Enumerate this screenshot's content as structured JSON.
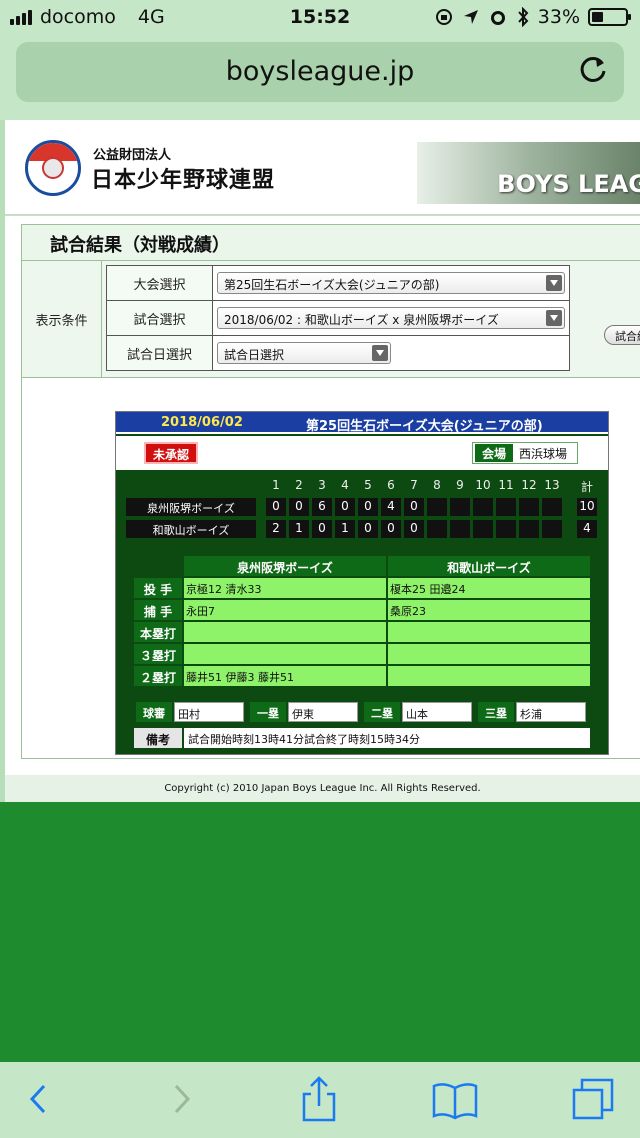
{
  "status_bar": {
    "carrier": "docomo",
    "network": "4G",
    "time": "15:52",
    "battery": "33%",
    "battery_level": 0.33
  },
  "browser": {
    "url": "boysleague.jp"
  },
  "header": {
    "org_type": "公益財団法人",
    "org_name": "日本少年野球連盟",
    "banner_text": "BOYS LEAG"
  },
  "section": {
    "title": "試合結果（対戦成績）"
  },
  "conditions": {
    "label": "表示条件",
    "rows": [
      {
        "label": "大会選択",
        "value": "第25回生石ボーイズ大会(ジュニアの部)"
      },
      {
        "label": "試合選択",
        "value": "2018/06/02 : 和歌山ボーイズ x 泉州阪堺ボーイズ"
      },
      {
        "label": "試合日選択",
        "value": "試合日選択"
      }
    ],
    "search_button": "試合結"
  },
  "result": {
    "date": "2018/06/02",
    "tournament": "第25回生石ボーイズ大会(ジュニアの部)",
    "status_badge": "未承認",
    "venue_label": "会場",
    "venue": "西浜球場",
    "innings": [
      "1",
      "2",
      "3",
      "4",
      "5",
      "6",
      "7",
      "8",
      "9",
      "10",
      "11",
      "12",
      "13",
      "計"
    ],
    "teams": [
      {
        "name": "泉州阪堺ボーイズ",
        "scores": [
          "0",
          "0",
          "6",
          "0",
          "0",
          "4",
          "0",
          "",
          "",
          "",
          "",
          "",
          "",
          "10"
        ]
      },
      {
        "name": "和歌山ボーイズ",
        "scores": [
          "2",
          "1",
          "0",
          "1",
          "0",
          "0",
          "0",
          "",
          "",
          "",
          "",
          "",
          "",
          "4"
        ]
      }
    ],
    "stat_team_headers": [
      "泉州阪堺ボーイズ",
      "和歌山ボーイズ"
    ],
    "stats": [
      {
        "label": "投 手",
        "home": "京極12 清水33",
        "away": "榎本25 田邉24"
      },
      {
        "label": "捕 手",
        "home": "永田7",
        "away": "桑原23"
      },
      {
        "label": "本塁打",
        "home": "",
        "away": ""
      },
      {
        "label": "３塁打",
        "home": "",
        "away": ""
      },
      {
        "label": "２塁打",
        "home": "藤井51 伊藤3 藤井51",
        "away": ""
      }
    ],
    "umpires": [
      {
        "label": "球審",
        "value": "田村"
      },
      {
        "label": "一塁",
        "value": "伊東"
      },
      {
        "label": "二塁",
        "value": "山本"
      },
      {
        "label": "三塁",
        "value": "杉浦"
      }
    ],
    "remark_label": "備考",
    "remark": "試合開始時刻13時41分試合終了時刻15時34分"
  },
  "footer": {
    "copyright": "Copyright (c) 2010 Japan Boys League Inc. All Rights Reserved."
  },
  "toolbar": {
    "icons": [
      "back-icon",
      "forward-icon",
      "share-icon",
      "bookmarks-icon",
      "tabs-icon"
    ]
  }
}
